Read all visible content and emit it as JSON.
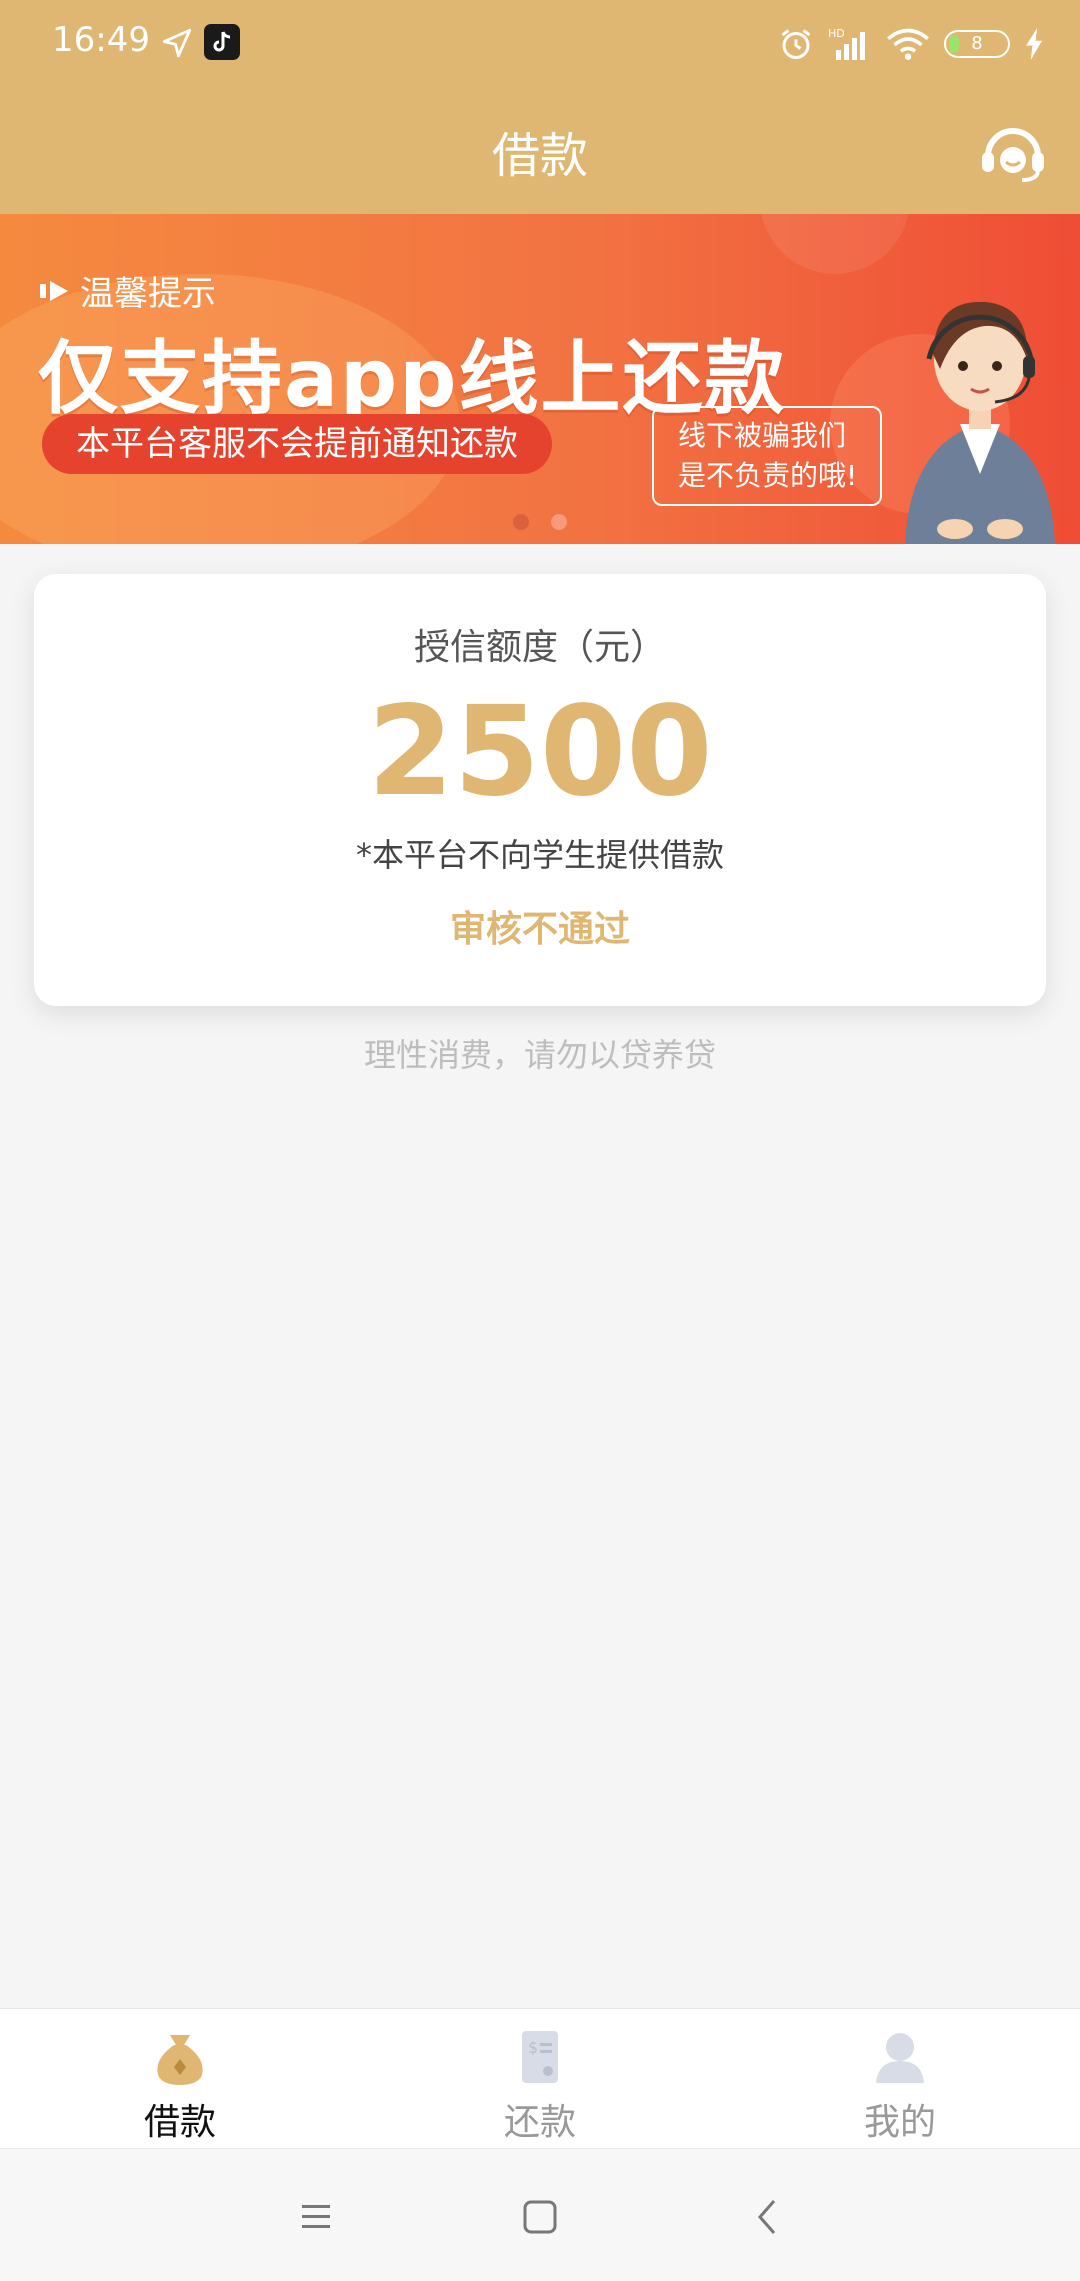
{
  "status_bar": {
    "time": "16:49",
    "battery_level": "8",
    "icons": [
      "location-arrow-icon",
      "tiktok-app-icon",
      "alarm-icon",
      "hd-signal-icon",
      "wifi-icon",
      "battery-icon",
      "charging-icon"
    ]
  },
  "app_bar": {
    "title": "借款",
    "support_icon": "customer-service-icon"
  },
  "banner": {
    "tip": "温馨提示",
    "headline": "仅支持app线上还款",
    "pill_text": "本平台客服不会提前通知还款",
    "bubble_line1": "线下被骗我们",
    "bubble_line2": "是不负责的哦!",
    "page_count": 2,
    "active_page": 1
  },
  "credit_card": {
    "label": "授信额度（元）",
    "amount": "2500",
    "note": "*本平台不向学生提供借款",
    "status": "审核不通过"
  },
  "footer_note": "理性消费，请勿以贷养贷",
  "tabs": [
    {
      "label": "借款",
      "icon": "money-bag-icon",
      "active": true
    },
    {
      "label": "还款",
      "icon": "bill-icon",
      "active": false
    },
    {
      "label": "我的",
      "icon": "user-icon",
      "active": false
    }
  ],
  "system_nav": {
    "buttons": [
      "menu-icon",
      "home-icon",
      "back-icon"
    ]
  },
  "colors": {
    "brand": "#dfb772",
    "banner_orange": "#f27242",
    "banner_red": "#e5432e"
  }
}
